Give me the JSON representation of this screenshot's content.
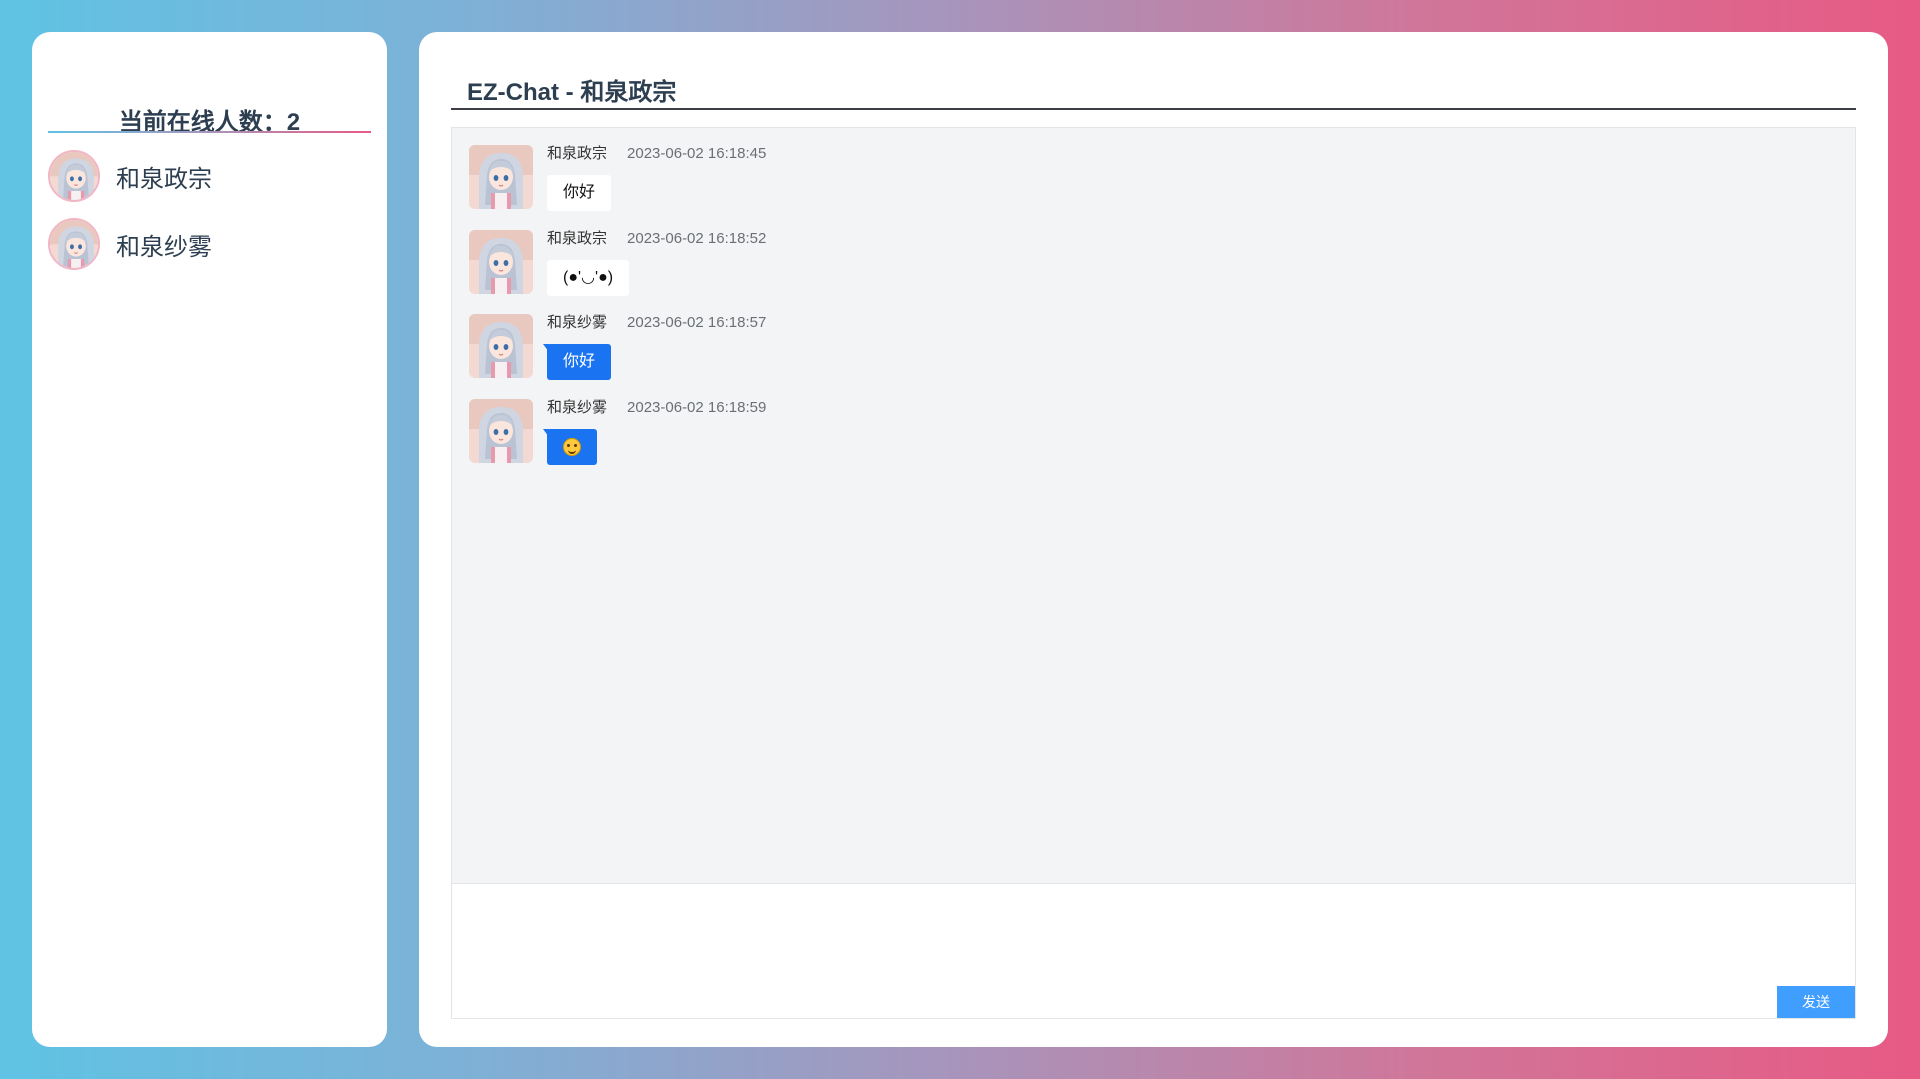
{
  "sidebar": {
    "online_label": "当前在线人数：2",
    "users": [
      {
        "name": "和泉政宗"
      },
      {
        "name": "和泉纱雾"
      }
    ]
  },
  "chat": {
    "title": "EZ-Chat - 和泉政宗",
    "messages": [
      {
        "user": "和泉政宗",
        "time": "2023-06-02 16:18:45",
        "text": "你好",
        "self": false
      },
      {
        "user": "和泉政宗",
        "time": "2023-06-02 16:18:52",
        "text": "(●'◡'●)",
        "self": false
      },
      {
        "user": "和泉纱雾",
        "time": "2023-06-02 16:18:57",
        "text": "你好",
        "self": true
      },
      {
        "user": "和泉纱雾",
        "time": "2023-06-02 16:18:59",
        "text": "",
        "icon": "smiling-face-emoji",
        "self": true
      }
    ],
    "send_label": "发送"
  },
  "colors": {
    "gradient_left": "#5fc3e4",
    "gradient_right": "#e75a85",
    "self_bubble": "#1a73f0",
    "send_button": "#409eff"
  }
}
